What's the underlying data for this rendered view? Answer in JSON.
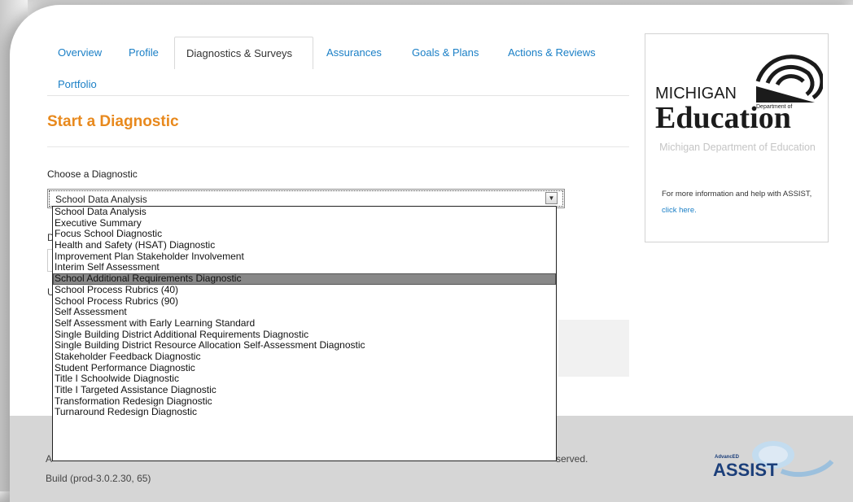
{
  "tabs": {
    "overview": "Overview",
    "profile": "Profile",
    "diagnostics": "Diagnostics & Surveys",
    "assurances": "Assurances",
    "goals": "Goals & Plans",
    "actions": "Actions & Reviews",
    "portfolio": "Portfolio"
  },
  "page": {
    "title": "Start a Diagnostic",
    "choose_label": "Choose a Diagnostic",
    "behind_label_1": "D",
    "behind_label_2": "U"
  },
  "select": {
    "value": "School Data Analysis",
    "arrow": "▼",
    "options": [
      "School Data Analysis",
      "Executive Summary",
      "Focus School Diagnostic",
      "Health and Safety (HSAT) Diagnostic",
      "Improvement Plan Stakeholder Involvement",
      "Interim Self Assessment",
      "School Additional Requirements Diagnostic",
      "School Process Rubrics (40)",
      "School Process Rubrics (90)",
      "Self Assessment",
      "Self Assessment with Early Learning Standard",
      "Single Building District Additional Requirements Diagnostic",
      "Single Building District Resource Allocation Self-Assessment Diagnostic",
      "Stakeholder Feedback Diagnostic",
      "Student Performance Diagnostic",
      "Title I Schoolwide Diagnostic",
      "Title I Targeted Assistance Diagnostic",
      "Transformation Redesign Diagnostic",
      "Turnaround Redesign Diagnostic"
    ],
    "highlighted_index": 6
  },
  "sidebar": {
    "logo_top": "MICHIGAN",
    "logo_sub": "Department of",
    "logo_main": "Education",
    "name": "Michigan Department of Education",
    "help_text": "For more information and help with ASSIST,",
    "help_link": "click here."
  },
  "footer": {
    "copy_start": "A",
    "copy_end": "served.",
    "build": "Build (prod-3.0.2.30, 65)",
    "logo_small": "AdvancED",
    "logo_text": "ASSIST"
  },
  "colors": {
    "link": "#1a7fc6",
    "title": "#e8891d",
    "footer_bg": "#d6d6d6",
    "highlight": "#888888"
  }
}
